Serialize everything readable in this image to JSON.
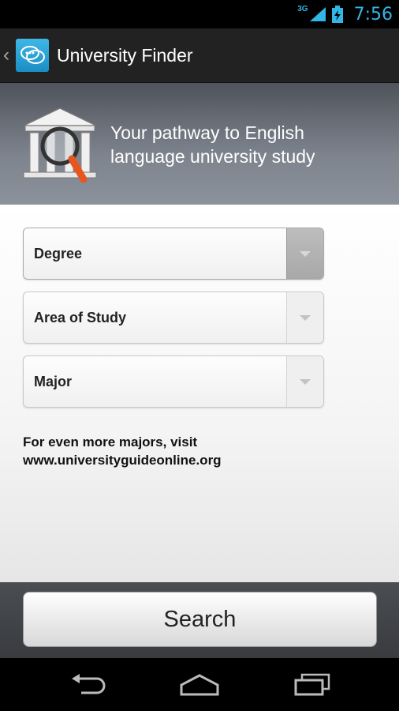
{
  "status_bar": {
    "network": "3G",
    "time": "7:56",
    "accent_color": "#33b5e5"
  },
  "action_bar": {
    "back_icon": "chevron-left-icon",
    "app_icon": "els-logo-icon",
    "title": "University Finder"
  },
  "banner": {
    "icon": "university-search-icon",
    "tagline": "Your pathway to English language university study"
  },
  "form": {
    "spinners": [
      {
        "label": "Degree"
      },
      {
        "label": "Area of Study"
      },
      {
        "label": "Major"
      }
    ],
    "note_line1": "For even more majors, visit",
    "note_line2": "www.universityguideonline.org"
  },
  "search_button": {
    "label": "Search"
  },
  "nav_bar": {
    "back": "back-icon",
    "home": "home-icon",
    "recents": "recent-apps-icon"
  }
}
